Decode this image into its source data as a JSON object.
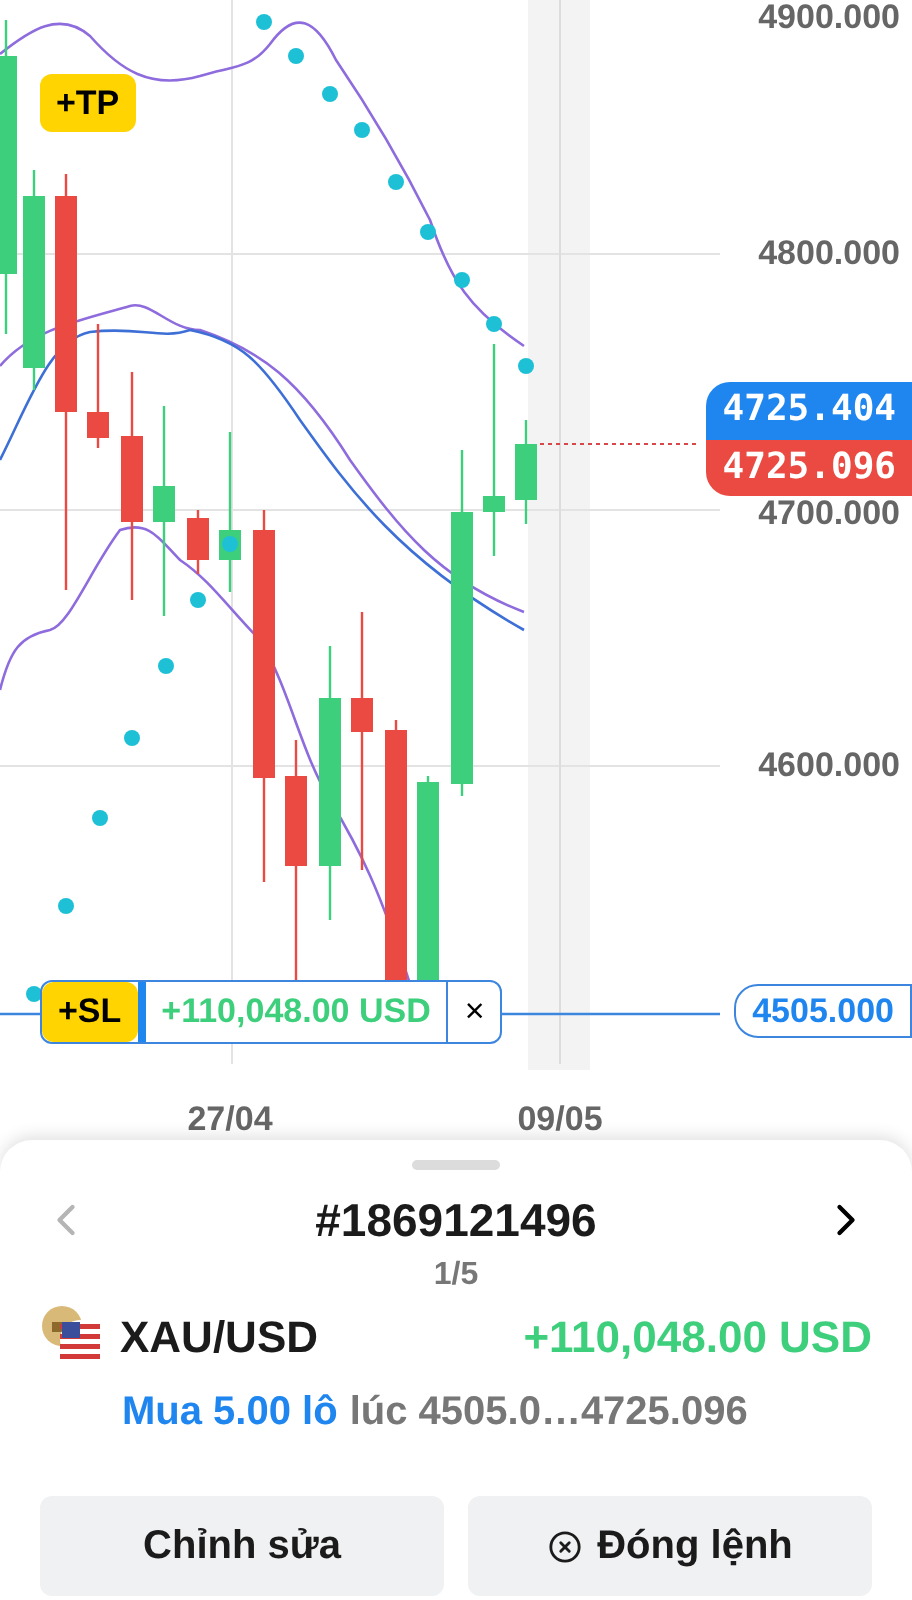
{
  "chart": {
    "price_ticks": [
      "4900.000",
      "4800.000",
      "4700.000",
      "4600.000"
    ],
    "date_ticks": [
      "27/04",
      "09/05"
    ],
    "tp_badge": "+TP",
    "ask_price": "4725.404",
    "bid_price": "4725.096",
    "sl_line": {
      "badge": "+SL",
      "profit": "+110,048.00 USD",
      "close": "×",
      "price": "4505.000"
    }
  },
  "position": {
    "ticket": "#1869121496",
    "page": "1/5",
    "prev": {
      "disabled": true
    },
    "next": {
      "disabled": false
    },
    "symbol": "XAU/USD",
    "profit": "+110,048.00 USD",
    "side": "Mua 5.00 lô",
    "price_range": "lúc 4505.0…4725.096"
  },
  "buttons": [
    {
      "label": "Chỉnh sửa",
      "kind": "edit"
    },
    {
      "label": "Đóng lệnh",
      "kind": "close"
    }
  ]
}
